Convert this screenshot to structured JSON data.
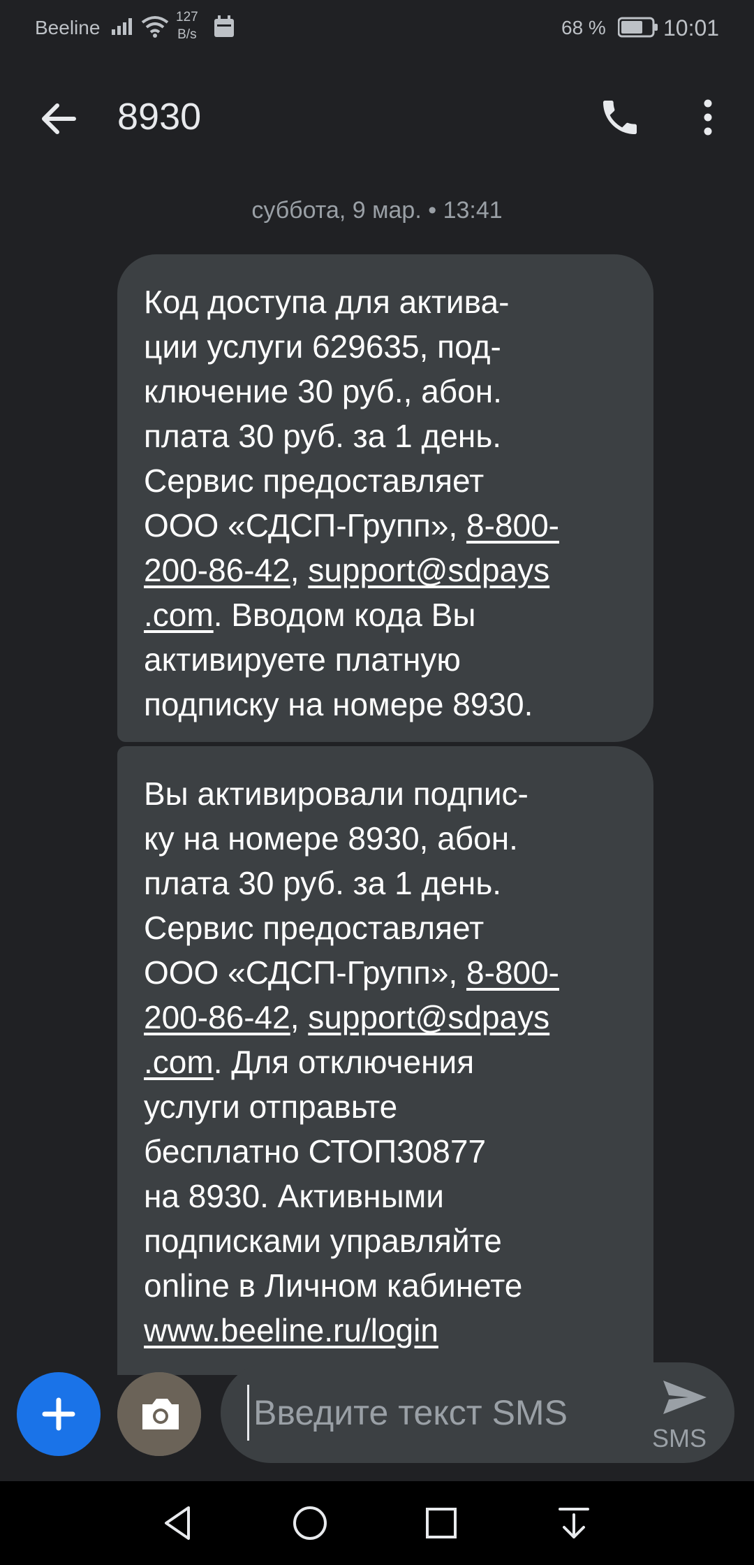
{
  "status_bar": {
    "carrier": "Beeline",
    "speed_value": "127",
    "speed_unit": "B/s",
    "battery_pct": "68 %",
    "time": "10:01"
  },
  "header": {
    "title": "8930",
    "icons": [
      "back-arrow-icon",
      "phone-icon",
      "more-vert-icon"
    ]
  },
  "conversation": {
    "date_separator": "суббота, 9 мар. • 13:41",
    "messages": [
      {
        "parts": [
          "Код доступа для актива-\nции услуги 629635, под-\nключение 30 руб., абон.\nплата 30 руб. за 1 день.\nСервис предоставляет\nООО «СДСП-Групп», ",
          "8-800-\n200-86-42",
          ", ",
          "support@sdpays\n.com",
          ". Вводом кода Вы\nактивируете платную\nподписку на номере 8930."
        ]
      },
      {
        "parts": [
          "Вы активировали подпис-\nку на номере 8930, абон.\nплата 30 руб. за 1 день.\nСервис предоставляет\nООО «СДСП-Групп», ",
          "8-800-\n200-86-42",
          ", ",
          "support@sdpays\n.com",
          ". Для отключения\nуслуги отправьте\nбесплатно СТОП30877\nна 8930. Активными\nподписками управляйте\nonline в Личном кабинете\n",
          "www.beeline.ru/login"
        ]
      }
    ]
  },
  "compose": {
    "placeholder": "Введите текст SMS",
    "send_label": "SMS",
    "accent_color": "#1a73e8"
  },
  "nav": {
    "icons": [
      "back-triangle-icon",
      "home-circle-icon",
      "recents-square-icon",
      "notification-pulldown-icon"
    ]
  }
}
